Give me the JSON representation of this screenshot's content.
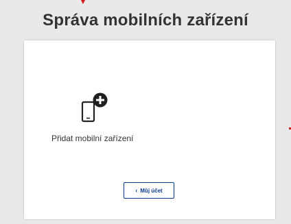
{
  "page": {
    "title": "Správa mobilních zařízení"
  },
  "card": {
    "add_device": {
      "label": "Přidat mobilní zařízení",
      "icon": "mobile-add-icon"
    },
    "back_button": {
      "label": "Můj účet",
      "icon": "chevron-left-icon"
    }
  },
  "colors": {
    "background": "#e9e9e9",
    "card": "#ffffff",
    "title": "#333333",
    "accent": "#0a3d8f",
    "marker": "#d01818"
  }
}
